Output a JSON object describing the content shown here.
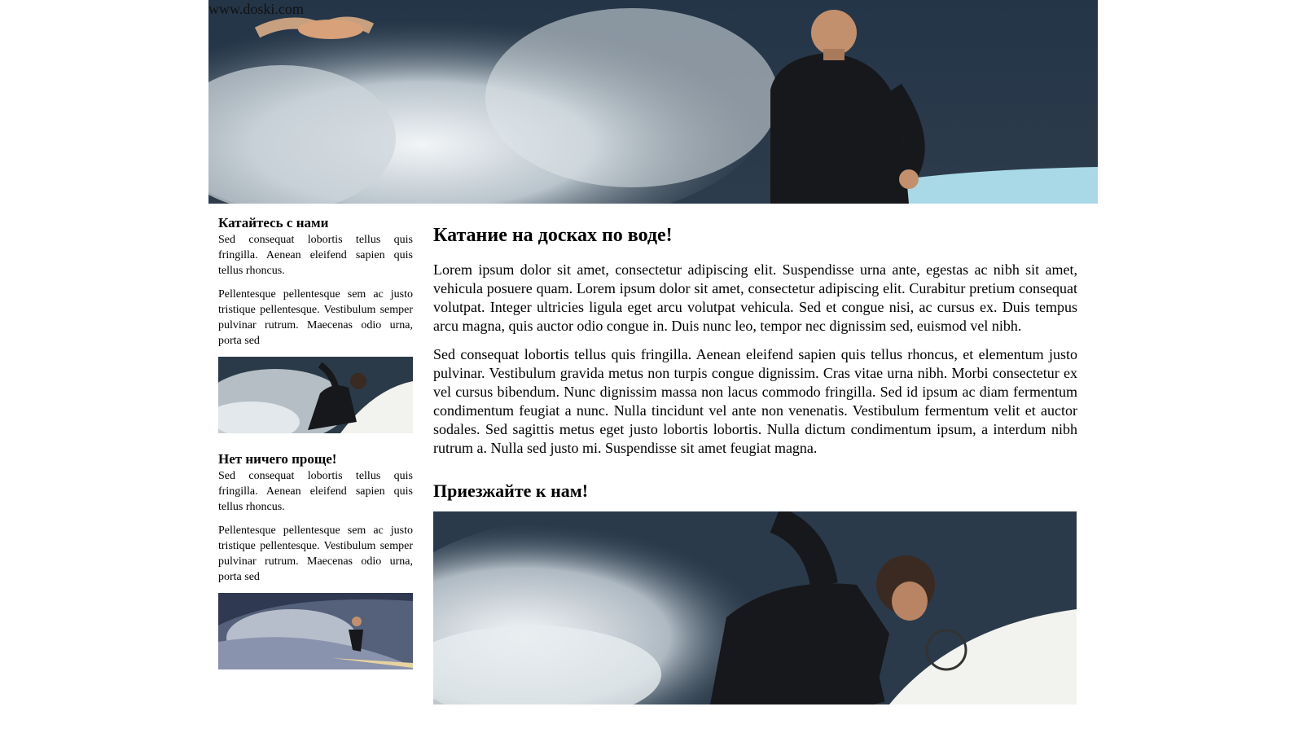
{
  "header": {
    "site_url": "www.doski.com",
    "image_icon": "surfer-photo"
  },
  "sidebar": {
    "sections": [
      {
        "title": "Катайтесь с нами",
        "paragraphs": [
          "Sed consequat lobortis tellus quis fringilla. Aenean eleifend sapien quis tellus rhoncus.",
          "Pellentesque pellentesque sem ac justo tristique pellentesque. Vestibulum semper pulvinar rutrum. Maecenas odio urna, porta sed"
        ],
        "image_icon": "surfer-photo"
      },
      {
        "title": "Нет ничего проще!",
        "paragraphs": [
          "Sed consequat lobortis tellus quis fringilla. Aenean eleifend sapien quis tellus rhoncus.",
          "Pellentesque pellentesque sem ac justo tristique pellentesque. Vestibulum semper pulvinar rutrum. Maecenas odio urna, porta sed"
        ],
        "image_icon": "surfer-photo"
      }
    ]
  },
  "main": {
    "heading": "Катание на досках по воде!",
    "paragraphs": [
      "Lorem ipsum dolor sit amet, consectetur adipiscing elit. Suspendisse urna ante, egestas ac nibh sit amet, vehicula posuere quam. Lorem ipsum dolor sit amet, consectetur adipiscing elit. Curabitur pretium consequat volutpat. Integer ultricies ligula eget arcu volutpat vehicula. Sed et congue nisi, ac cursus ex. Duis tempus arcu magna, quis auctor odio congue in. Duis nunc leo, tempor nec dignissim sed, euismod vel nibh.",
      "Sed consequat lobortis tellus quis fringilla. Aenean eleifend sapien quis tellus rhoncus, et elementum justo pulvinar. Vestibulum gravida metus non turpis congue dignissim. Cras vitae urna nibh. Morbi consectetur ex vel cursus bibendum. Nunc dignissim massa non lacus commodo fringilla. Sed id ipsum ac diam fermentum condimentum feugiat a nunc. Nulla tincidunt vel ante non venenatis. Vestibulum fermentum velit et auctor sodales. Sed sagittis metus eget justo lobortis lobortis. Nulla dictum condimentum ipsum, a interdum nibh rutrum a. Nulla sed justo mi. Suspendisse sit amet feugiat magna."
    ],
    "subheading": "Приезжайте к нам!",
    "image_icon": "surfer-photo"
  },
  "colors": {
    "water_dark": "#1f2b3a",
    "water_mid": "#3b4f63",
    "spray": "#e8eef2",
    "wetsuit": "#16181c",
    "board_blue": "#a9d8e6",
    "board_white": "#f2f2ee"
  }
}
